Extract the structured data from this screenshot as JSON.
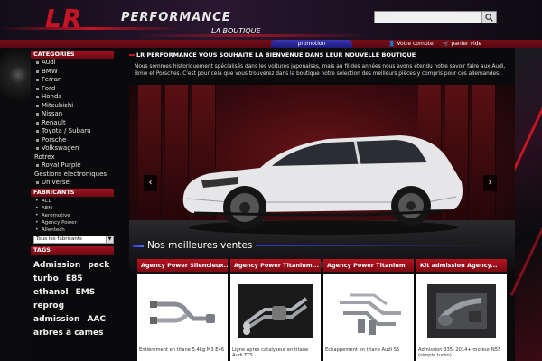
{
  "header": {
    "logo_lr": "LR",
    "logo_performance": "PERFORMANCE",
    "logo_subtitle": "LA BOUTIQUE",
    "search_placeholder": ""
  },
  "topbar": {
    "promotion": "promotion",
    "account": "Votre compte",
    "cart": "panier vide"
  },
  "sidebar": {
    "categories_title": "CATEGORIES",
    "categories": [
      {
        "label": "Audi",
        "level": "sub"
      },
      {
        "label": "BMW",
        "level": "sub"
      },
      {
        "label": "Ferrari",
        "level": "sub"
      },
      {
        "label": "Ford",
        "level": "sub"
      },
      {
        "label": "Honda",
        "level": "sub"
      },
      {
        "label": "Mitsubishi",
        "level": "sub"
      },
      {
        "label": "Nissan",
        "level": "sub"
      },
      {
        "label": "Renault",
        "level": "sub"
      },
      {
        "label": "Toyota / Subaru",
        "level": "sub"
      },
      {
        "label": "Porsche",
        "level": "sub"
      },
      {
        "label": "Volkswagen",
        "level": "sub"
      },
      {
        "label": "Rotrex",
        "level": "top"
      },
      {
        "label": "Royal Purple",
        "level": "sub"
      },
      {
        "label": "Gestions électroniques",
        "level": "top"
      },
      {
        "label": "Universel",
        "level": "sub"
      }
    ],
    "manufacturers_title": "FABRICANTS",
    "manufacturers": [
      "ACL",
      "AEM",
      "Aeromotive",
      "Agency Power",
      "Allentech"
    ],
    "manufacturers_select": "Tous les fabricants",
    "tags_title": "TAGS",
    "tags": [
      "Admission",
      "pack",
      "turbo",
      "E85",
      "ethanol",
      "EMS",
      "reprog",
      "admission",
      "AAC",
      "arbres à cames"
    ]
  },
  "main": {
    "welcome": "LR PERFORMANCE VOUS SOUHAITE LA BIENVENUE DANS LEUR NOUVELLE BOUTIQUE",
    "intro": "Nous sommes historiquement spécialisés dans les voitures japonaises, mais au fil des années nous avons étendu notre savoir faire aux Audi, Bmw et Porsches. C'est pour cela que vous trouverez dans la boutique notre selection des meilleurs pièces y compris pour ces allemandes.",
    "slider_prev": "‹",
    "slider_next": "›",
    "slides_count": 8,
    "active_slide": 1,
    "best_sellers_title": "Nos meilleures ventes",
    "products": [
      {
        "title": "Agency Power Silencieux...",
        "desc": "Entièrement en titane 5.4kg M3 E46",
        "image": "exhaust-y-pipe"
      },
      {
        "title": "Agency Power Titanium...",
        "desc": "Ligne Après catalyseur en titane Audi TTS",
        "image": "exhaust-system"
      },
      {
        "title": "Agency Power Titanium",
        "desc": "Echappement en titane Audi S5",
        "image": "exhaust-pipes"
      },
      {
        "title": "Kit admission Agency...",
        "desc": "Admission 335i 2014+ moteur N55 (simple turbo)",
        "image": "intake-kit"
      }
    ]
  }
}
